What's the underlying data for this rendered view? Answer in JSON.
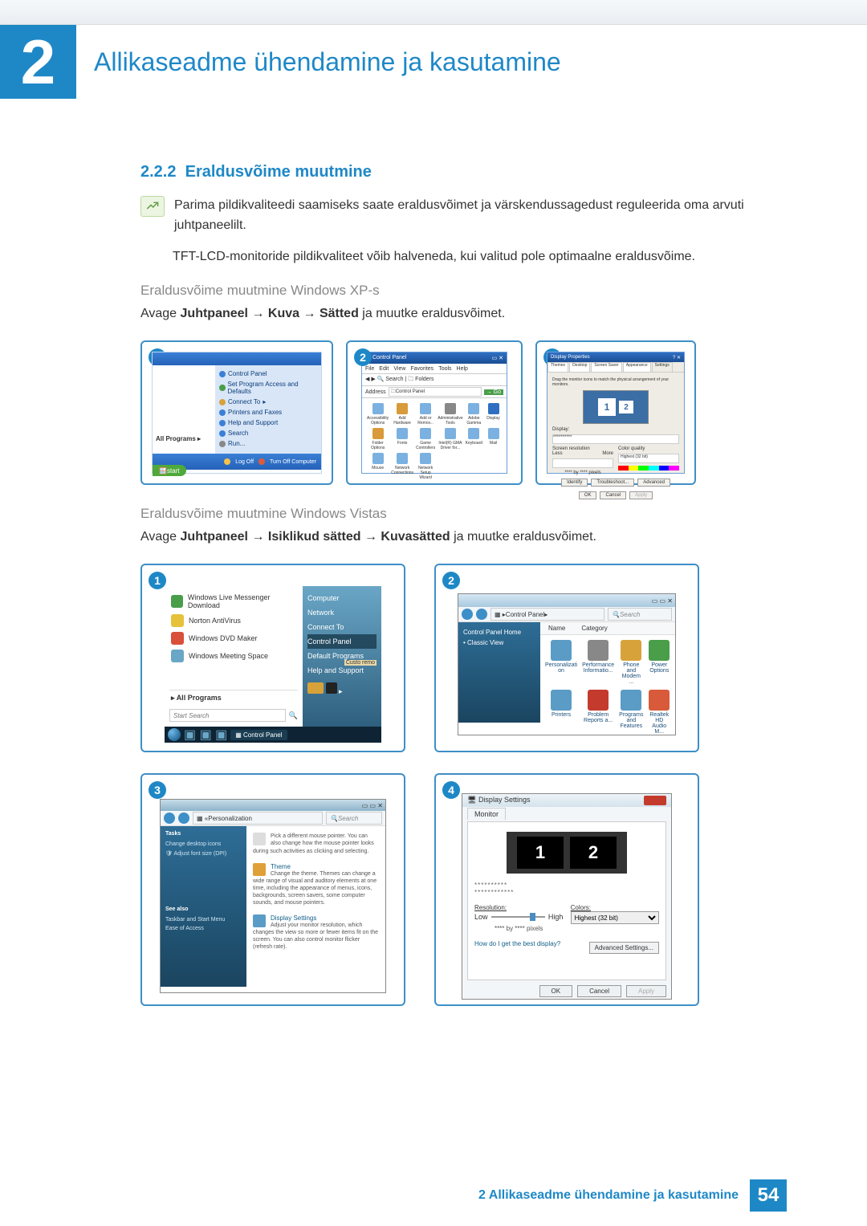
{
  "chapter": {
    "number": "2",
    "title": "Allikaseadme ühendamine ja kasutamine"
  },
  "section": {
    "number": "2.2.2",
    "title": "Eraldusvõime muutmine"
  },
  "info_p1": "Parima pildikvaliteedi saamiseks saate eraldusvõimet ja värskendussagedust reguleerida oma arvuti juhtpaneelilt.",
  "info_p2": "TFT-LCD-monitoride pildikvaliteet võib halveneda, kui valitud pole optimaalne eraldusvõime.",
  "xp": {
    "heading": "Eraldusvõime muutmine Windows XP-s",
    "instr_pre": "Avage ",
    "path_1": "Juhtpaneel",
    "arrow": "→",
    "path_2": "Kuva",
    "path_3": "Sätted",
    "instr_post": " ja muutke eraldusvõimet.",
    "fig1": {
      "right_items": [
        "Control Panel",
        "Set Program Access and Defaults",
        "Connect To",
        "Printers and Faxes",
        "Help and Support",
        "Search",
        "Run..."
      ],
      "all_programs": "All Programs",
      "logoff": "Log Off",
      "turnoff": "Turn Off Computer",
      "start": "start"
    },
    "fig2": {
      "title": "Control Panel",
      "menu": [
        "File",
        "Edit",
        "View",
        "Favorites",
        "Tools",
        "Help"
      ],
      "address_label": "Address",
      "address_value": "Control Panel",
      "toolbar": [
        "Search",
        "Folders"
      ],
      "icons": [
        "Accessibility Options",
        "Add Hardware",
        "Add or Remov...",
        "Administrative Tools",
        "Adobe Gamma",
        "Display",
        "Folder Options",
        "Fonts",
        "Game Controllers",
        "Intel(R) GMA Driver for...",
        "Keyboard",
        "Mail",
        "Mouse",
        "Network Connections",
        "Network Setup Wizard"
      ]
    },
    "fig3": {
      "title": "Display Properties",
      "tabs": [
        "Themes",
        "Desktop",
        "Screen Saver",
        "Appearance",
        "Settings"
      ],
      "desc": "Drag the monitor icons to match the physical arrangement of your monitors.",
      "mon1": "1",
      "mon2": "2",
      "display_label": "Display:",
      "screen_res": "Screen resolution",
      "less": "Less",
      "more": "More",
      "color_q": "Color quality",
      "color_val": "Highest (32 bit)",
      "pixels": "**** by **** pixels",
      "identify": "Identify",
      "troubleshoot": "Troubleshoot...",
      "advanced": "Advanced",
      "ok": "OK",
      "cancel": "Cancel",
      "apply": "Apply"
    }
  },
  "vista": {
    "heading": "Eraldusvõime muutmine Windows Vistas",
    "instr_pre": "Avage ",
    "path_1": "Juhtpaneel",
    "arrow": "→",
    "path_2": "Isiklikud sätted",
    "path_3": "Kuvasätted",
    "instr_post": " ja muutke eraldusvõimet.",
    "fig1": {
      "items": [
        "Windows Live Messenger Download",
        "Norton AntiVirus",
        "Windows DVD Maker",
        "Windows Meeting Space"
      ],
      "all_programs": "All Programs",
      "search_placeholder": "Start Search",
      "right": [
        "Computer",
        "Network",
        "Connect To",
        "Control Panel",
        "Default Programs",
        "Help and Support"
      ],
      "right_extra": "Custo remo",
      "taskbar": "Control Panel"
    },
    "fig2": {
      "breadcrumb": "Control Panel",
      "search": "Search",
      "cols": [
        "Name",
        "Category"
      ],
      "side_title": "Control Panel Home",
      "side_item": "Classic View",
      "icons": [
        "Personalizati on",
        "Performance Informatio...",
        "Phone and Modem ...",
        "Power Options",
        "Printers",
        "Problem Reports a...",
        "Programs and Features",
        "Realtek HD Audio M..."
      ]
    },
    "fig3": {
      "breadcrumb": "Personalization",
      "search": "Search",
      "side": {
        "heading": "Tasks",
        "items": [
          "Change desktop icons",
          "Adjust font size (DPI)"
        ],
        "see_also": "See also",
        "see_items": [
          "Taskbar and Start Menu",
          "Ease of Access"
        ]
      },
      "groups": [
        {
          "icon": "mouse",
          "title": "",
          "body": "Pick a different mouse pointer. You can also change how the mouse pointer looks during such activities as clicking and selecting."
        },
        {
          "icon": "theme",
          "title": "Theme",
          "body": "Change the theme. Themes can change a wide range of visual and auditory elements at one time, including the appearance of menus, icons, backgrounds, screen savers, some computer sounds, and mouse pointers."
        },
        {
          "icon": "display",
          "title": "Display Settings",
          "body": "Adjust your monitor resolution, which changes the view so more or fewer items fit on the screen. You can also control monitor flicker (refresh rate)."
        }
      ]
    },
    "fig4": {
      "title": "Display Settings",
      "tab": "Monitor",
      "mon1": "1",
      "mon2": "2",
      "dots1": "**********",
      "dots2": "************",
      "resolution": "Resolution:",
      "low": "Low",
      "high": "High",
      "pixels": "**** by **** pixels",
      "colors": "Colors:",
      "colors_val": "Highest (32 bit)",
      "link": "How do I get the best display?",
      "advanced": "Advanced Settings...",
      "ok": "OK",
      "cancel": "Cancel",
      "apply": "Apply"
    }
  },
  "footer": {
    "text": "2 Allikaseadme ühendamine ja kasutamine",
    "page": "54"
  }
}
